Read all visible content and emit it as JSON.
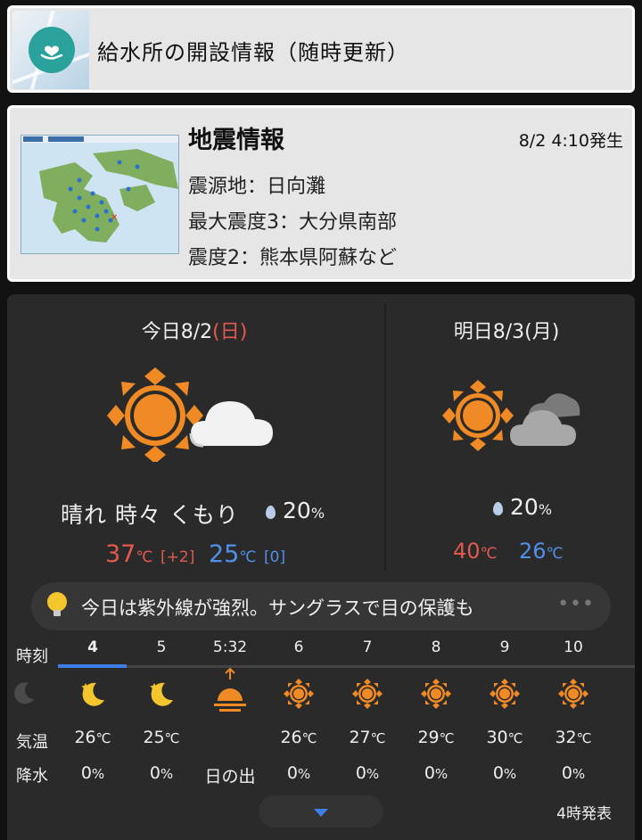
{
  "water": {
    "title": "給水所の開設情報（随時更新）",
    "icon": "heart-hand-icon"
  },
  "quake": {
    "title": "地震情報",
    "time": "8/2 4:10発生",
    "epicenter": "震源地：日向灘",
    "max_intensity": "最大震度3：大分県南部",
    "intensity2": "震度2：熊本県阿蘇など"
  },
  "today": {
    "label": "今日8/2",
    "dow": "(日)",
    "condition": "晴れ 時々 くもり",
    "pop": "20",
    "pop_unit": "%",
    "high": "37",
    "high_unit": "℃",
    "high_diff": "[+2]",
    "low": "25",
    "low_unit": "℃",
    "low_diff": "[0]",
    "icon": "sun-cloud-icon"
  },
  "tomorrow": {
    "label": "明日8/3(月)",
    "pop": "20",
    "pop_unit": "%",
    "high": "40",
    "high_unit": "℃",
    "low": "26",
    "low_unit": "℃",
    "icon": "sun-cloud-icon"
  },
  "advice": {
    "text": "今日は紫外線が強烈。サングラスで目の保護も",
    "more": "•••"
  },
  "hourly": {
    "row_time": "時刻",
    "row_temp": "気温",
    "row_rain": "降水",
    "columns": [
      {
        "time": "4",
        "icon": "moon",
        "temp": "26",
        "unit": "℃",
        "rain": "0",
        "rain_unit": "%"
      },
      {
        "time": "5",
        "icon": "moon",
        "temp": "25",
        "unit": "℃",
        "rain": "0",
        "rain_unit": "%"
      },
      {
        "time": "5:32",
        "icon": "sunrise",
        "temp": "",
        "unit": "",
        "rain": "日の出",
        "rain_unit": ""
      },
      {
        "time": "6",
        "icon": "sun",
        "temp": "26",
        "unit": "℃",
        "rain": "0",
        "rain_unit": "%"
      },
      {
        "time": "7",
        "icon": "sun",
        "temp": "27",
        "unit": "℃",
        "rain": "0",
        "rain_unit": "%"
      },
      {
        "time": "8",
        "icon": "sun",
        "temp": "29",
        "unit": "℃",
        "rain": "0",
        "rain_unit": "%"
      },
      {
        "time": "9",
        "icon": "sun",
        "temp": "30",
        "unit": "℃",
        "rain": "0",
        "rain_unit": "%"
      },
      {
        "time": "10",
        "icon": "sun",
        "temp": "32",
        "unit": "℃",
        "rain": "0",
        "rain_unit": "%"
      }
    ]
  },
  "issued": "4時発表",
  "colors": {
    "accent": "#3d7de8",
    "hot": "#e25a4f",
    "cold": "#4f90e8",
    "sun": "#f08a24"
  }
}
